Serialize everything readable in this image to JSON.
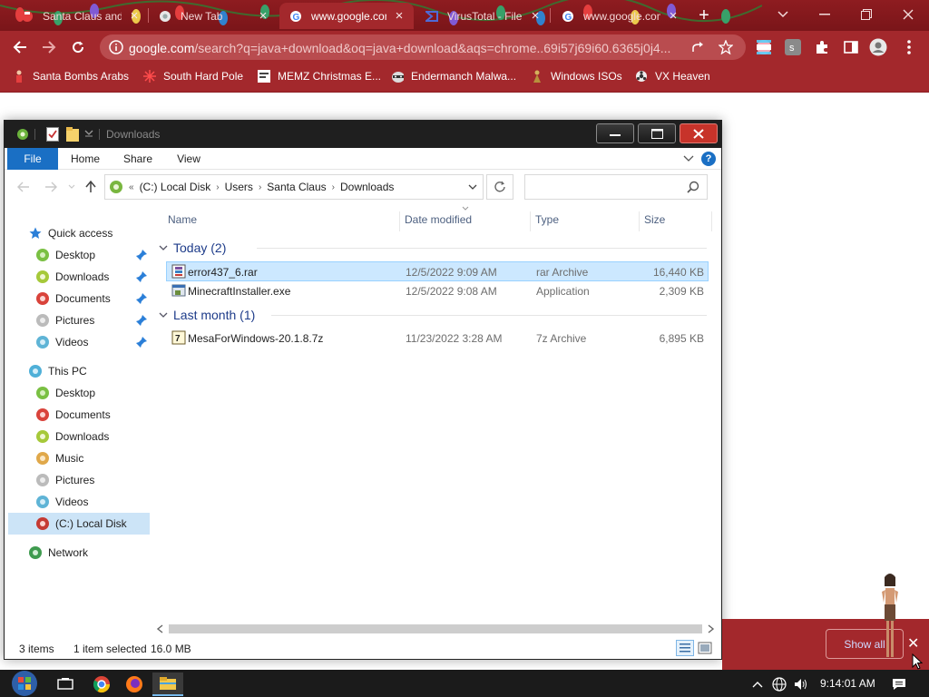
{
  "browser": {
    "tabs": [
      {
        "title": "Santa Claus and",
        "active": false
      },
      {
        "title": "New Tab",
        "active": false
      },
      {
        "title": "www.google.com",
        "active": true
      },
      {
        "title": "VirusTotal - File",
        "active": false
      },
      {
        "title": "www.google.com",
        "active": false
      }
    ],
    "new_tab_label": "+",
    "url": {
      "host": "google.com",
      "path": "/search?q=java+download&oq=java+download&aqs=chrome..69i57j69i60.6365j0j4..."
    },
    "bookmarks": [
      "Santa Bombs Arabs",
      "South Hard Pole",
      "MEMZ Christmas E...",
      "Endermanch Malwa...",
      "Windows ISOs",
      "VX Heaven"
    ],
    "profile_letter": "s",
    "accent_color": "#a3282c"
  },
  "explorer": {
    "title": "Downloads",
    "ribbon_tabs": [
      "File",
      "Home",
      "Share",
      "View"
    ],
    "help_label": "?",
    "breadcrumb_prefix": "«",
    "breadcrumb": [
      "(C:) Local Disk",
      "Users",
      "Santa Claus",
      "Downloads"
    ],
    "search_placeholder": "",
    "nav": {
      "quick_access": "Quick access",
      "quick_items": [
        "Desktop",
        "Downloads",
        "Documents",
        "Pictures",
        "Videos"
      ],
      "this_pc": "This PC",
      "pc_items": [
        "Desktop",
        "Documents",
        "Downloads",
        "Music",
        "Pictures",
        "Videos",
        "(C:) Local Disk"
      ],
      "network": "Network"
    },
    "columns": [
      "Name",
      "Date modified",
      "Type",
      "Size"
    ],
    "groups": [
      {
        "label": "Today (2)",
        "files": [
          {
            "name": "error437_6.rar",
            "date": "12/5/2022 9:09 AM",
            "type": "rar Archive",
            "size": "16,440 KB",
            "selected": true
          },
          {
            "name": "MinecraftInstaller.exe",
            "date": "12/5/2022 9:08 AM",
            "type": "Application",
            "size": "2,309 KB",
            "selected": false
          }
        ]
      },
      {
        "label": "Last month (1)",
        "files": [
          {
            "name": "MesaForWindows-20.1.8.7z",
            "date": "11/23/2022 3:28 AM",
            "type": "7z Archive",
            "size": "6,895 KB",
            "selected": false
          }
        ]
      }
    ],
    "status": {
      "items": "3 items",
      "selected": "1 item selected",
      "size": "16.0 MB"
    },
    "selection_color": "#cce8ff"
  },
  "download_shelf": {
    "show_all": "Show all",
    "close": "✕"
  },
  "taskbar": {
    "clock": "9:14:01 AM"
  }
}
